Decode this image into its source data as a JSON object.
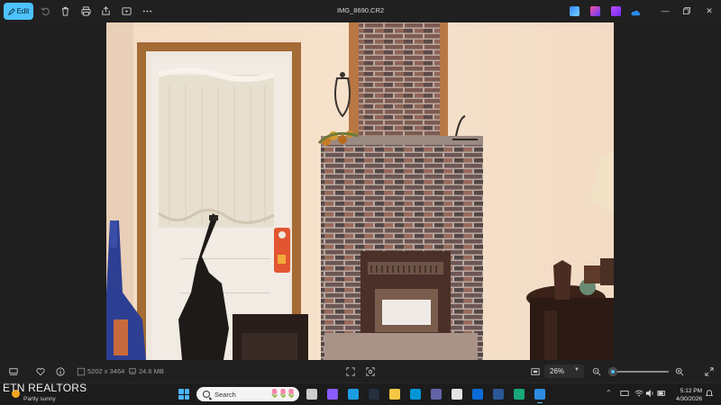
{
  "app": {
    "file_name": "IMG_8690.CR2",
    "edit_label": "Edit",
    "toolbar_icons": [
      "edit-icon",
      "rotate-icon",
      "delete-icon",
      "print-icon",
      "share-icon",
      "slideshow-icon",
      "more-icon"
    ],
    "window_controls": [
      "minimize",
      "maximize",
      "close"
    ]
  },
  "status": {
    "dimensions": "5202 x 3464",
    "file_size": "24.6 MB",
    "zoom_level": "26%",
    "zoom_fraction": 0.03
  },
  "taskbar": {
    "weather_brand": "ETN REALTORS",
    "weather_condition": "Partly sunny",
    "search_placeholder": "Search",
    "time": "5:12 PM",
    "date": "4/30/2026",
    "apps": [
      {
        "name": "task-view",
        "color": "#cccccc"
      },
      {
        "name": "copilot",
        "color": "#8a5cff"
      },
      {
        "name": "edge",
        "color": "#1b9de2"
      },
      {
        "name": "amazon",
        "color": "#232f3e"
      },
      {
        "name": "file-explorer",
        "color": "#f6c744"
      },
      {
        "name": "hp",
        "color": "#0096d6"
      },
      {
        "name": "store",
        "color": "#6264a7"
      },
      {
        "name": "photos-app",
        "color": "#e3e3e3"
      },
      {
        "name": "mail",
        "color": "#0a6cd8"
      },
      {
        "name": "news",
        "color": "#2b5797"
      },
      {
        "name": "defender",
        "color": "#18a77a"
      },
      {
        "name": "photos",
        "color": "#2d8ce0"
      }
    ]
  },
  "colors": {
    "accent": "#4cc2ff",
    "chrome": "#202020",
    "canvas": "#1f1f1f"
  }
}
